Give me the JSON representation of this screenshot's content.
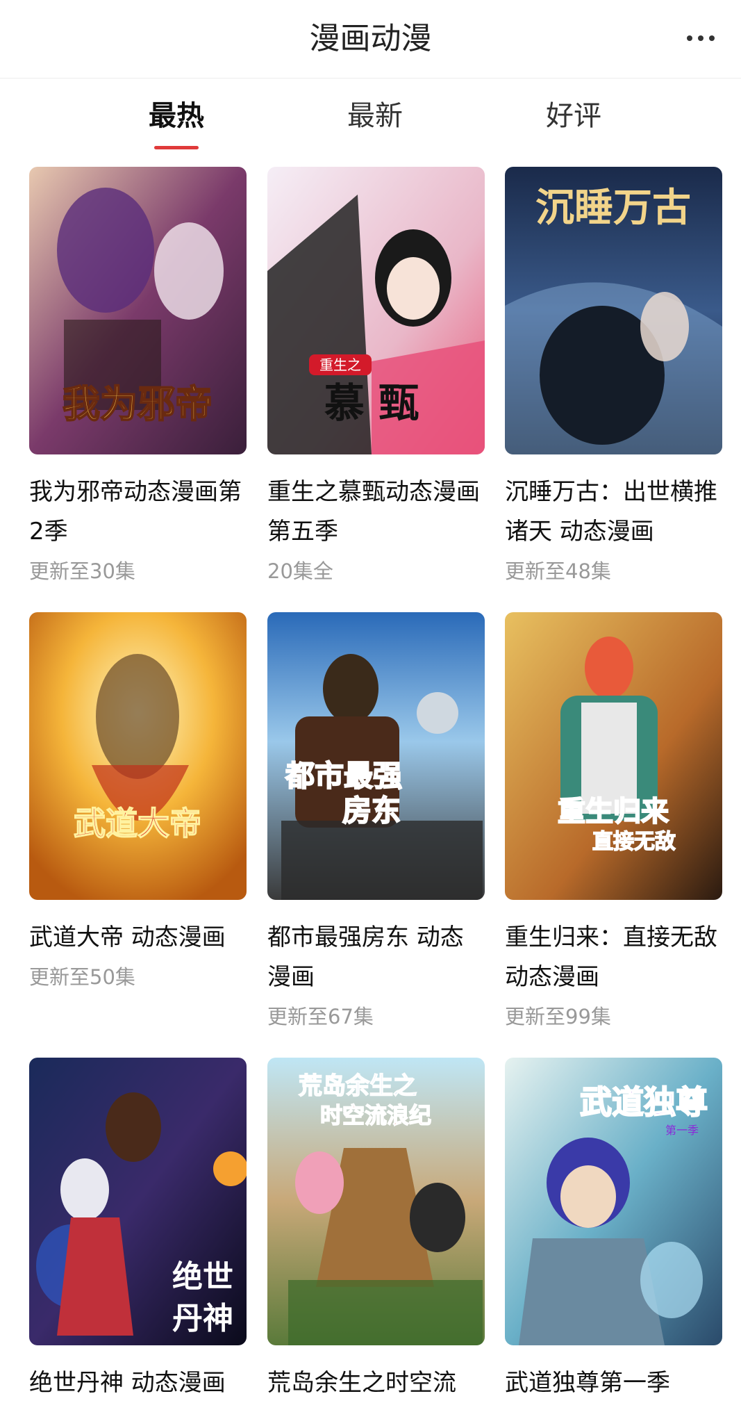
{
  "header": {
    "title": "漫画动漫",
    "more_icon": "more-dots-icon"
  },
  "tabs": [
    {
      "label": "最热",
      "active": true
    },
    {
      "label": "最新",
      "active": false
    },
    {
      "label": "好评",
      "active": false
    }
  ],
  "accent_color": "#e03a3a",
  "items": [
    {
      "name": "我为邪帝动态漫画第2季",
      "episodes": "更新至30集",
      "cover_text": "我为邪帝"
    },
    {
      "name": "重生之慕甄动态漫画第五季",
      "episodes": "20集全",
      "cover_text": "重生之慕甄"
    },
    {
      "name": "沉睡万古：出世横推诸天 动态漫画",
      "episodes": "更新至48集",
      "cover_text": "沉睡万古"
    },
    {
      "name": "武道大帝 动态漫画",
      "episodes": "更新至50集",
      "cover_text": "武道大帝"
    },
    {
      "name": "都市最强房东 动态漫画",
      "episodes": "更新至67集",
      "cover_text": "都市最强房东"
    },
    {
      "name": "重生归来：直接无敌 动态漫画",
      "episodes": "更新至99集",
      "cover_text": "重生归来直接无敌"
    },
    {
      "name": "绝世丹神 动态漫画",
      "episodes": "",
      "cover_text": "绝世丹神"
    },
    {
      "name": "荒岛余生之时空流",
      "episodes": "",
      "cover_text": "荒岛余生之时空流浪纪"
    },
    {
      "name": "武道独尊第一季",
      "episodes": "",
      "cover_text": "武道独尊"
    }
  ]
}
